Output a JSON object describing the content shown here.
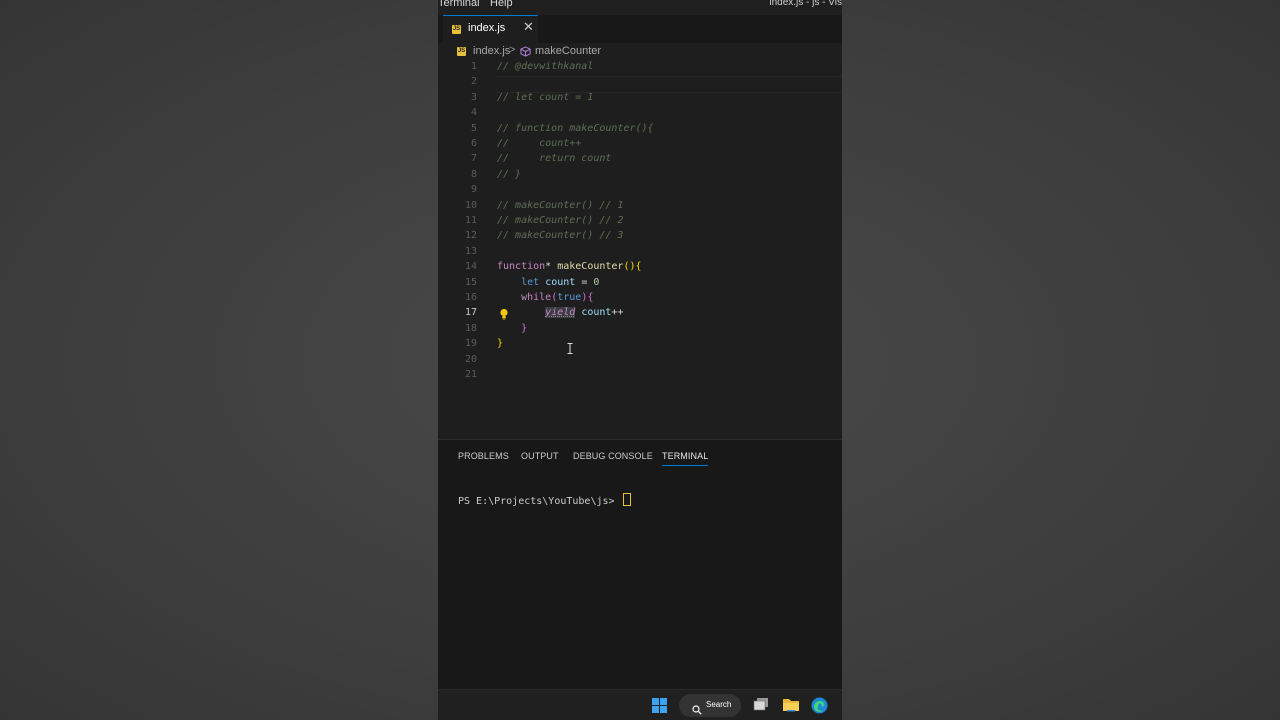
{
  "titlebar": {
    "menu": [
      "Terminal",
      "Help"
    ],
    "title": "index.js - js - Vis"
  },
  "tab": {
    "label": "index.js",
    "close": "✕",
    "badge": "JS"
  },
  "breadcrumb": {
    "file": "index.js",
    "separator": ">",
    "symbol": "makeCounter"
  },
  "code_lines": [
    {
      "n": "1",
      "parts": [
        {
          "t": "// @devwithkanal",
          "c": "c-com"
        }
      ]
    },
    {
      "n": "2",
      "parts": []
    },
    {
      "n": "3",
      "parts": [
        {
          "t": "// let count = 1",
          "c": "c-com"
        }
      ]
    },
    {
      "n": "4",
      "parts": []
    },
    {
      "n": "5",
      "parts": [
        {
          "t": "// function makeCounter(){",
          "c": "c-com"
        }
      ]
    },
    {
      "n": "6",
      "parts": [
        {
          "t": "//     count++",
          "c": "c-com"
        }
      ]
    },
    {
      "n": "7",
      "parts": [
        {
          "t": "//     return count",
          "c": "c-com"
        }
      ]
    },
    {
      "n": "8",
      "parts": [
        {
          "t": "// }",
          "c": "c-com"
        }
      ]
    },
    {
      "n": "9",
      "parts": []
    },
    {
      "n": "10",
      "parts": [
        {
          "t": "// makeCounter() // 1",
          "c": "c-com"
        }
      ]
    },
    {
      "n": "11",
      "parts": [
        {
          "t": "// makeCounter() // 2",
          "c": "c-com"
        }
      ]
    },
    {
      "n": "12",
      "parts": [
        {
          "t": "// makeCounter() // 3",
          "c": "c-com"
        }
      ]
    },
    {
      "n": "13",
      "parts": []
    },
    {
      "n": "14",
      "parts": [
        {
          "t": "function",
          "c": "c-kw"
        },
        {
          "t": "* ",
          "c": "c-plain"
        },
        {
          "t": "makeCounter",
          "c": "c-fn"
        },
        {
          "t": "()",
          "c": "c-p1"
        },
        {
          "t": "{",
          "c": "c-p1"
        }
      ]
    },
    {
      "n": "15",
      "parts": [
        {
          "t": "    ",
          "c": "c-plain"
        },
        {
          "t": "let",
          "c": "c-let"
        },
        {
          "t": " ",
          "c": "c-plain"
        },
        {
          "t": "count",
          "c": "c-var"
        },
        {
          "t": " = ",
          "c": "c-plain"
        },
        {
          "t": "0",
          "c": "c-num"
        }
      ]
    },
    {
      "n": "16",
      "parts": [
        {
          "t": "    ",
          "c": "c-plain"
        },
        {
          "t": "while",
          "c": "c-kw"
        },
        {
          "t": "(",
          "c": "c-p2"
        },
        {
          "t": "true",
          "c": "c-let"
        },
        {
          "t": ")",
          "c": "c-p2"
        },
        {
          "t": "{",
          "c": "c-p2"
        }
      ]
    },
    {
      "n": "17",
      "parts": [
        {
          "t": "        ",
          "c": "c-plain"
        },
        {
          "t": "yield",
          "c": "c-yield"
        },
        {
          "t": " ",
          "c": "c-plain"
        },
        {
          "t": "count",
          "c": "c-var"
        },
        {
          "t": "++",
          "c": "c-plain"
        }
      ],
      "active": true
    },
    {
      "n": "18",
      "parts": [
        {
          "t": "    ",
          "c": "c-plain"
        },
        {
          "t": "}",
          "c": "c-p2"
        }
      ]
    },
    {
      "n": "19",
      "parts": [
        {
          "t": "}",
          "c": "c-p1"
        }
      ]
    },
    {
      "n": "20",
      "parts": []
    },
    {
      "n": "21",
      "parts": []
    }
  ],
  "panel": {
    "tabs": [
      "PROBLEMS",
      "OUTPUT",
      "DEBUG CONSOLE",
      "TERMINAL"
    ],
    "active_tab": "TERMINAL",
    "prompt": "PS E:\\Projects\\YouTube\\js> "
  },
  "taskbar": {
    "search_label": "Search"
  },
  "colors": {
    "accent": "#0078d4",
    "js_badge": "#e8c23a",
    "editor_bg": "#1e1e1e"
  }
}
